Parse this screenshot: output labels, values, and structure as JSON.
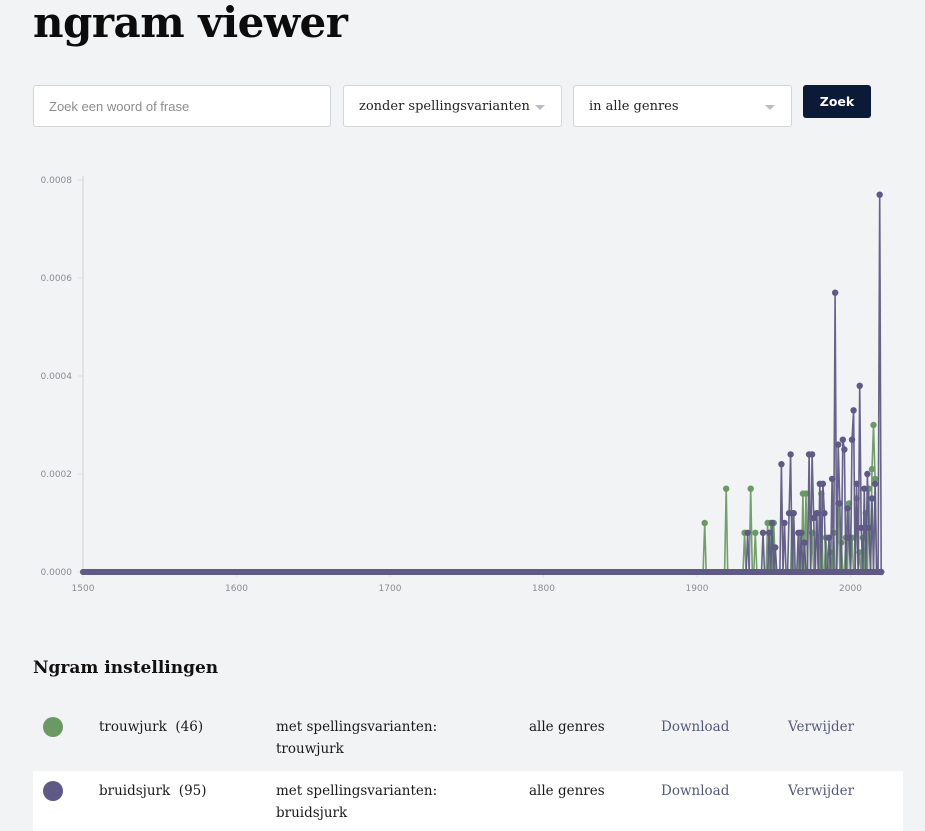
{
  "header": {
    "title": "ngram viewer"
  },
  "search": {
    "placeholder": "Zoek een woord of frase",
    "value": "",
    "spelling_select": "zonder spellingsvarianten",
    "genre_select": "in alle genres",
    "submit_label": "Zoek"
  },
  "colors": {
    "trouwjurk": "#6a9a63",
    "bruidsjurk": "#5e5a85",
    "button": "#0b1a38"
  },
  "chart_data": {
    "type": "line",
    "title": "",
    "xlabel": "",
    "ylabel": "",
    "xlim": [
      1500,
      2020
    ],
    "ylim": [
      0,
      0.0008
    ],
    "x_ticks": [
      "1500",
      "1600",
      "1700",
      "1800",
      "1900",
      "2000"
    ],
    "y_ticks": [
      "0.0000",
      "0.0002",
      "0.0004",
      "0.0006",
      "0.0008"
    ],
    "grid": false,
    "legend": "none",
    "baseline_note": "both series are 0 for all years 1500-1900 except listed points",
    "series": [
      {
        "name": "trouwjurk",
        "color": "#6a9a63",
        "points": [
          [
            1905,
            0.0001
          ],
          [
            1919,
            0.00017
          ],
          [
            1931,
            8e-05
          ],
          [
            1935,
            0.00017
          ],
          [
            1938,
            8e-05
          ],
          [
            1946,
            0.0001
          ],
          [
            1948,
            0.0001
          ],
          [
            1950,
            0.0001
          ],
          [
            1962,
            0.00012
          ],
          [
            1967,
            8e-05
          ],
          [
            1969,
            0.00016
          ],
          [
            1971,
            0.00016
          ],
          [
            1975,
            8e-05
          ],
          [
            1978,
            0.00012
          ],
          [
            1981,
            0.00016
          ],
          [
            1984,
            7e-05
          ],
          [
            1987,
            4e-05
          ],
          [
            1989,
            8e-05
          ],
          [
            1992,
            0.00014
          ],
          [
            1994,
            6e-05
          ],
          [
            1997,
            7e-05
          ],
          [
            1999,
            0.00014
          ],
          [
            2001,
            7e-05
          ],
          [
            2004,
            0.00015
          ],
          [
            2006,
            4e-05
          ],
          [
            2008,
            7e-05
          ],
          [
            2010,
            0.00012
          ],
          [
            2012,
            0.00017
          ],
          [
            2014,
            0.00021
          ],
          [
            2015,
            0.0003
          ],
          [
            2016,
            0.00019
          ]
        ]
      },
      {
        "name": "bruidsjurk",
        "color": "#5e5a85",
        "points": [
          [
            1933,
            8e-05
          ],
          [
            1943,
            8e-05
          ],
          [
            1947,
            8e-05
          ],
          [
            1949,
            0.0001
          ],
          [
            1951,
            5e-05
          ],
          [
            1955,
            0.00022
          ],
          [
            1957,
            0.0001
          ],
          [
            1960,
            0.00012
          ],
          [
            1961,
            0.00024
          ],
          [
            1963,
            0.00012
          ],
          [
            1966,
            8e-05
          ],
          [
            1968,
            8e-05
          ],
          [
            1970,
            6e-05
          ],
          [
            1973,
            0.00024
          ],
          [
            1975,
            0.00024
          ],
          [
            1976,
            0.00011
          ],
          [
            1978,
            0.00012
          ],
          [
            1980,
            0.00018
          ],
          [
            1982,
            0.00018
          ],
          [
            1983,
            0.00012
          ],
          [
            1986,
            7e-05
          ],
          [
            1988,
            0.00019
          ],
          [
            1990,
            0.00057
          ],
          [
            1992,
            0.00026
          ],
          [
            1993,
            0.00014
          ],
          [
            1995,
            0.00027
          ],
          [
            1996,
            0.00025
          ],
          [
            1998,
            0.00013
          ],
          [
            1999,
            7e-05
          ],
          [
            2001,
            0.00027
          ],
          [
            2002,
            0.00033
          ],
          [
            2004,
            0.00018
          ],
          [
            2006,
            0.00038
          ],
          [
            2007,
            9e-05
          ],
          [
            2009,
            0.00017
          ],
          [
            2011,
            0.0002
          ],
          [
            2012,
            9e-05
          ],
          [
            2014,
            0.00015
          ],
          [
            2016,
            0.00018
          ],
          [
            2019,
            0.00077
          ],
          [
            2020,
            0.0
          ]
        ]
      }
    ]
  },
  "settings": {
    "title": "Ngram instellingen",
    "rows": [
      {
        "term": "trouwjurk",
        "count": "(46)",
        "variants_label": "met spellingsvarianten:",
        "variants": "trouwjurk",
        "genres": "alle genres",
        "download": "Download",
        "remove": "Verwijder"
      },
      {
        "term": "bruidsjurk",
        "count": "(95)",
        "variants_label": "met spellingsvarianten:",
        "variants": "bruidsjurk",
        "genres": "alle genres",
        "download": "Download",
        "remove": "Verwijder"
      }
    ]
  }
}
